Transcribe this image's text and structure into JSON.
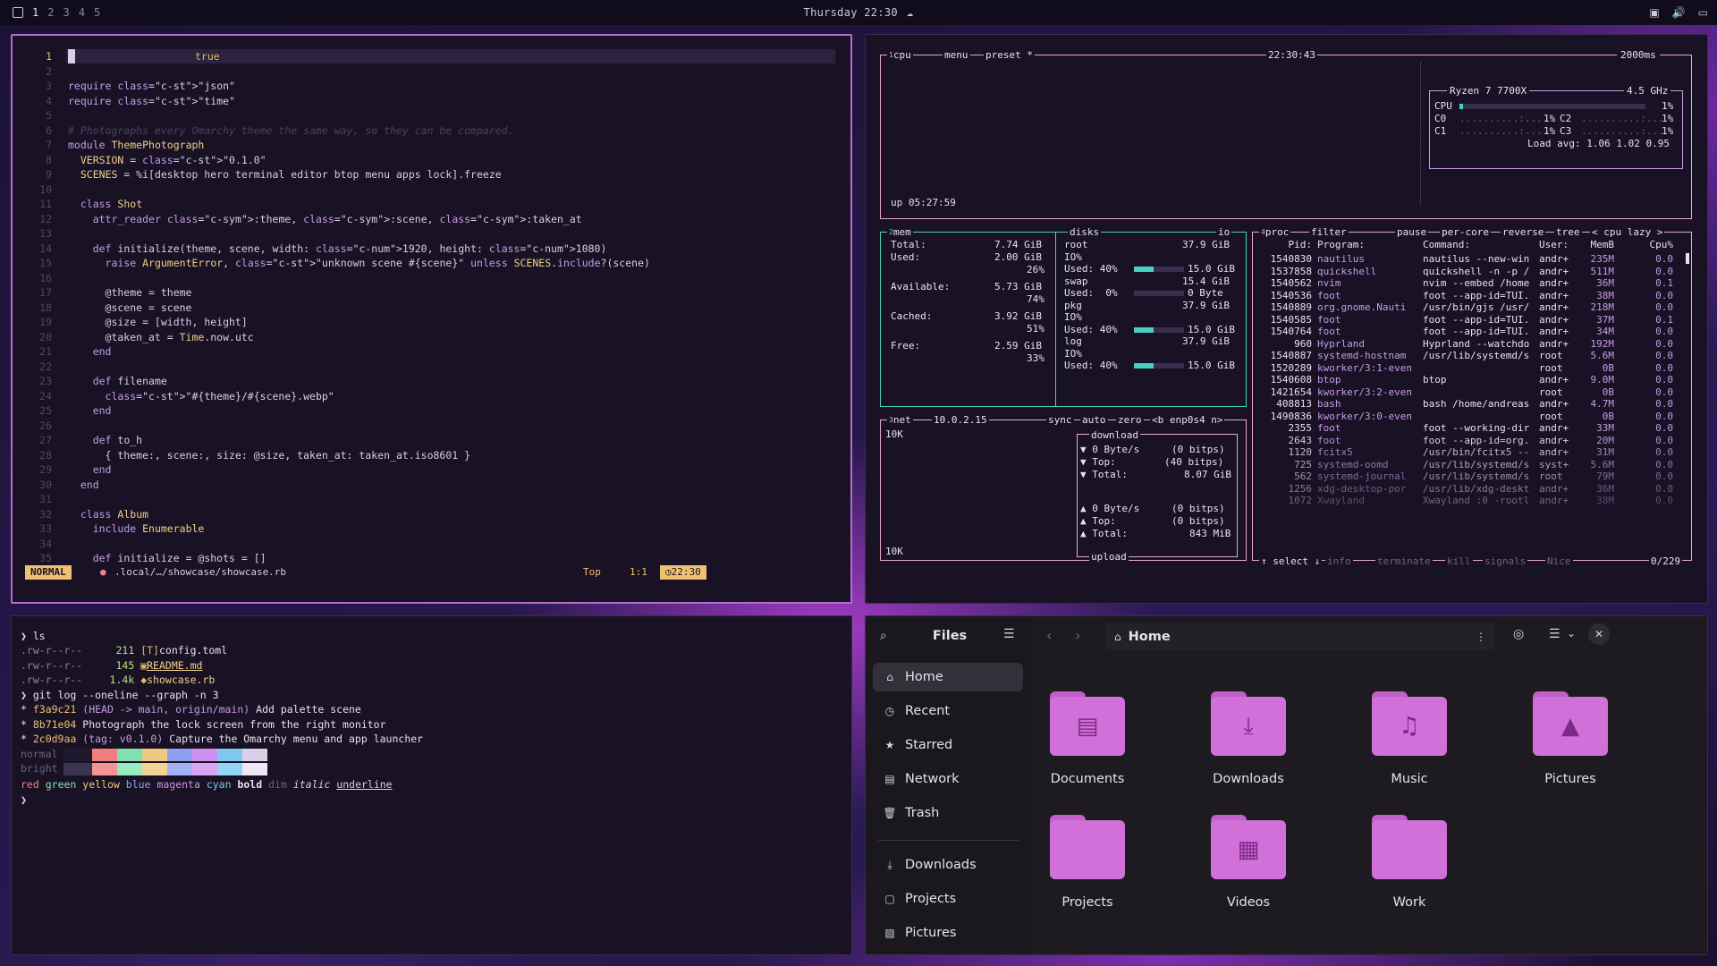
{
  "topbar": {
    "workspaces": [
      "1",
      "2",
      "3",
      "4",
      "5"
    ],
    "active_workspace": "1",
    "clock": "Thursday 22:30",
    "tray_icons": [
      "screen-icon",
      "volume-icon",
      "display-icon"
    ]
  },
  "editor": {
    "lines": [
      {
        "n": "1",
        "html": "#\t\t\t\t\t\ttrue"
      },
      {
        "n": "2",
        "text": ""
      },
      {
        "n": "3",
        "text": "require \"json\""
      },
      {
        "n": "4",
        "text": "require \"time\""
      },
      {
        "n": "5",
        "text": ""
      },
      {
        "n": "6",
        "text": "# Photographs every Omarchy theme the same way, so they can be compared."
      },
      {
        "n": "7",
        "text": "module ThemePhotograph"
      },
      {
        "n": "8",
        "text": "  VERSION = \"0.1.0\""
      },
      {
        "n": "9",
        "text": "  SCENES = %i[desktop hero terminal editor btop menu apps lock].freeze"
      },
      {
        "n": "10",
        "text": ""
      },
      {
        "n": "11",
        "text": "  class Shot"
      },
      {
        "n": "12",
        "text": "    attr_reader :theme, :scene, :taken_at"
      },
      {
        "n": "13",
        "text": ""
      },
      {
        "n": "14",
        "text": "    def initialize(theme, scene, width: 1920, height: 1080)"
      },
      {
        "n": "15",
        "text": "      raise ArgumentError, \"unknown scene #{scene}\" unless SCENES.include?(scene)"
      },
      {
        "n": "16",
        "text": ""
      },
      {
        "n": "17",
        "text": "      @theme = theme"
      },
      {
        "n": "18",
        "text": "      @scene = scene"
      },
      {
        "n": "19",
        "text": "      @size = [width, height]"
      },
      {
        "n": "20",
        "text": "      @taken_at = Time.now.utc"
      },
      {
        "n": "21",
        "text": "    end"
      },
      {
        "n": "22",
        "text": ""
      },
      {
        "n": "23",
        "text": "    def filename"
      },
      {
        "n": "24",
        "text": "      \"#{theme}/#{scene}.webp\""
      },
      {
        "n": "25",
        "text": "    end"
      },
      {
        "n": "26",
        "text": ""
      },
      {
        "n": "27",
        "text": "    def to_h"
      },
      {
        "n": "28",
        "text": "      { theme:, scene:, size: @size, taken_at: taken_at.iso8601 }"
      },
      {
        "n": "29",
        "text": "    end"
      },
      {
        "n": "30",
        "text": "  end"
      },
      {
        "n": "31",
        "text": ""
      },
      {
        "n": "32",
        "text": "  class Album"
      },
      {
        "n": "33",
        "text": "    include Enumerable"
      },
      {
        "n": "34",
        "text": ""
      },
      {
        "n": "35",
        "text": "    def initialize = @shots = []"
      }
    ],
    "first_line_value": "true",
    "mode": "NORMAL",
    "filepath": ".local/…/showcase/showcase.rb",
    "position": "Top",
    "rowcol": "1:1",
    "time": "22:30"
  },
  "btop": {
    "cpu_box": {
      "label": "cpu",
      "label_num": "1",
      "menu": "menu",
      "preset": "preset *",
      "time": "22:30:43",
      "interval": "2000ms",
      "uptime": "up 05:27:59",
      "cpu_name": "Ryzen 7 7700X",
      "freq": "4.5 GHz",
      "cpu_label": "CPU",
      "cpu_pct": "1%",
      "cores": [
        {
          "name": "C0",
          "pct": "1%"
        },
        {
          "name": "C1",
          "pct": "1%"
        },
        {
          "name": "C2",
          "pct": "1%"
        },
        {
          "name": "C3",
          "pct": "1%"
        }
      ],
      "load_avg": "Load avg: 1.06 1.02 0.95"
    },
    "mem_box": {
      "label": "mem",
      "label_num": "2",
      "disks_label": "disks",
      "io_label": "io",
      "total_label": "Total:",
      "total": "7.74 GiB",
      "used_label": "Used:",
      "used": "2.00 GiB",
      "used_pct": "26%",
      "avail_label": "Available:",
      "avail": "5.73 GiB",
      "avail_pct": "74%",
      "cached_label": "Cached:",
      "cached": "3.92 GiB",
      "cached_pct": "51%",
      "free_label": "Free:",
      "free": "2.59 GiB",
      "free_pct": "33%",
      "disks": [
        {
          "name": "root",
          "size": "37.9 GiB",
          "io": "IO%",
          "used_label": "Used: 40%",
          "used": "15.0 GiB",
          "fill": 0.4
        },
        {
          "name": "swap",
          "size": "15.4 GiB",
          "io": "",
          "used_label": "Used:  0%",
          "used": "0 Byte",
          "fill": 0.0
        },
        {
          "name": "pkg",
          "size": "37.9 GiB",
          "io": "IO%",
          "used_label": "Used: 40%",
          "used": "15.0 GiB",
          "fill": 0.4
        },
        {
          "name": "log",
          "size": "37.9 GiB",
          "io": "IO%",
          "used_label": "Used: 40%",
          "used": "15.0 GiB",
          "fill": 0.4
        }
      ]
    },
    "net_box": {
      "label": "net",
      "label_num": "3",
      "ip": "10.0.2.15",
      "sync": "sync",
      "auto": "auto",
      "zero": "zero",
      "iface": "<b enp0s4 n>",
      "scale_top": "10K",
      "scale_bottom": "10K",
      "download": "download",
      "dl_rate": "▼ 0 Byte/s",
      "dl_bits": "(0 bitps)",
      "dl_top": "▼ Top:",
      "dl_top_bits": "(40 bitps)",
      "dl_total": "▼ Total:",
      "dl_total_val": "8.07 GiB",
      "ul_rate": "▲ 0 Byte/s",
      "ul_bits": "(0 bitps)",
      "ul_top": "▲ Top:",
      "ul_top_bits": "(0 bitps)",
      "ul_total": "▲ Total:",
      "ul_total_val": "843 MiB",
      "upload": "upload"
    },
    "proc_box": {
      "label": "proc",
      "label_num": "4",
      "filter": "filter",
      "pause": "pause",
      "percore": "per-core",
      "reverse": "reverse",
      "tree": "tree",
      "sort": "< cpu lazy >",
      "headers": {
        "pid": "Pid:",
        "prog": "Program:",
        "cmd": "Command:",
        "user": "User:",
        "mem": "MemB",
        "cpu": "Cpu%"
      },
      "rows": [
        {
          "pid": "1540830",
          "prog": "nautilus",
          "cmd": "nautilus --new-win",
          "user": "andr+",
          "mem": "235M",
          "cpu": "0.0"
        },
        {
          "pid": "1537858",
          "prog": "quickshell",
          "cmd": "quickshell -n -p /",
          "user": "andr+",
          "mem": "511M",
          "cpu": "0.0"
        },
        {
          "pid": "1540562",
          "prog": "nvim",
          "cmd": "nvim --embed /home",
          "user": "andr+",
          "mem": "36M",
          "cpu": "0.1"
        },
        {
          "pid": "1540536",
          "prog": "foot",
          "cmd": "foot --app-id=TUI.",
          "user": "andr+",
          "mem": "38M",
          "cpu": "0.0"
        },
        {
          "pid": "1540889",
          "prog": "org.gnome.Nauti",
          "cmd": "/usr/bin/gjs /usr/",
          "user": "andr+",
          "mem": "218M",
          "cpu": "0.0"
        },
        {
          "pid": "1540585",
          "prog": "foot",
          "cmd": "foot --app-id=TUI.",
          "user": "andr+",
          "mem": "37M",
          "cpu": "0.1"
        },
        {
          "pid": "1540764",
          "prog": "foot",
          "cmd": "foot --app-id=TUI.",
          "user": "andr+",
          "mem": "34M",
          "cpu": "0.0"
        },
        {
          "pid": "960",
          "prog": "Hyprland",
          "cmd": "Hyprland --watchdo",
          "user": "andr+",
          "mem": "192M",
          "cpu": "0.0"
        },
        {
          "pid": "1540887",
          "prog": "systemd-hostnam",
          "cmd": "/usr/lib/systemd/s",
          "user": "root",
          "mem": "5.6M",
          "cpu": "0.0"
        },
        {
          "pid": "1520289",
          "prog": "kworker/3:1-even",
          "cmd": "",
          "user": "root",
          "mem": "0B",
          "cpu": "0.0"
        },
        {
          "pid": "1540608",
          "prog": "btop",
          "cmd": "btop",
          "user": "andr+",
          "mem": "9.0M",
          "cpu": "0.0"
        },
        {
          "pid": "1421654",
          "prog": "kworker/3:2-even",
          "cmd": "",
          "user": "root",
          "mem": "0B",
          "cpu": "0.0"
        },
        {
          "pid": "408813",
          "prog": "bash",
          "cmd": "bash /home/andreas",
          "user": "andr+",
          "mem": "4.7M",
          "cpu": "0.0"
        },
        {
          "pid": "1490836",
          "prog": "kworker/3:0-even",
          "cmd": "",
          "user": "root",
          "mem": "0B",
          "cpu": "0.0"
        },
        {
          "pid": "2355",
          "prog": "foot",
          "cmd": "foot --working-dir",
          "user": "andr+",
          "mem": "33M",
          "cpu": "0.0"
        },
        {
          "pid": "2643",
          "prog": "foot",
          "cmd": "foot --app-id=org.",
          "user": "andr+",
          "mem": "20M",
          "cpu": "0.0"
        },
        {
          "pid": "1120",
          "prog": "fcitx5",
          "cmd": "/usr/bin/fcitx5 --",
          "user": "andr+",
          "mem": "31M",
          "cpu": "0.0"
        },
        {
          "pid": "725",
          "prog": "systemd-oomd",
          "cmd": "/usr/lib/systemd/s",
          "user": "syst+",
          "mem": "5.6M",
          "cpu": "0.0"
        },
        {
          "pid": "562",
          "prog": "systemd-journal",
          "cmd": "/usr/lib/systemd/s",
          "user": "root",
          "mem": "79M",
          "cpu": "0.0"
        },
        {
          "pid": "1256",
          "prog": "xdg-desktop-por",
          "cmd": "/usr/lib/xdg-deskt",
          "user": "andr+",
          "mem": "36M",
          "cpu": "0.0"
        },
        {
          "pid": "1072",
          "prog": "Xwayland",
          "cmd": "Xwayland :0 -rootl",
          "user": "andr+",
          "mem": "38M",
          "cpu": "0.0"
        }
      ],
      "footer_select": "↑ select ↓",
      "footer_info": "info",
      "footer_terminate": "terminate",
      "footer_kill": "kill",
      "footer_signals": "signals",
      "footer_nice": "Nice",
      "count": "0/229"
    }
  },
  "terminal": {
    "prompt": "❯",
    "cmd1": "ls",
    "files": [
      {
        "perm": ".rw-r--r--",
        "size": "211",
        "icon": "[T]",
        "name": "config.toml"
      },
      {
        "perm": ".rw-r--r--",
        "size": "145",
        "icon": "▣",
        "name": "README.md"
      },
      {
        "perm": ".rw-r--r--",
        "size": "1.4k",
        "icon": "◆",
        "name": "showcase.rb"
      }
    ],
    "cmd2": "git log --oneline --graph -n 3",
    "commits": [
      {
        "hash": "f3a9c21",
        "ref": "(HEAD -> main, origin/main)",
        "msg": "Add palette scene"
      },
      {
        "hash": "8b71e04",
        "ref": "",
        "msg": "Photograph the lock screen from the right monitor"
      },
      {
        "hash": "2c0d9aa",
        "ref": "(tag: v0.1.0)",
        "msg": "Capture the Omarchy menu and app launcher"
      }
    ],
    "normal_label": "normal",
    "bright_label": "bright",
    "normal_colors": [
      "#1e1a2e",
      "#f08080",
      "#80e0b0",
      "#f0c880",
      "#90a0f0",
      "#d090f0",
      "#80c8f0",
      "#d8d0e8"
    ],
    "bright_colors": [
      "#3a3450",
      "#f49494",
      "#94ecc0",
      "#f4d494",
      "#a4b0f4",
      "#dca4f4",
      "#94d4f4",
      "#eee8f6"
    ],
    "styles": [
      "red",
      "green",
      "yellow",
      "blue",
      "magenta",
      "cyan",
      "bold",
      "dim",
      "italic",
      "underline"
    ]
  },
  "files": {
    "sidebar_title": "Files",
    "path": "Home",
    "sidebar_items": [
      {
        "label": "Home",
        "icon": "home-icon",
        "selected": true
      },
      {
        "label": "Recent",
        "icon": "clock-icon",
        "selected": false
      },
      {
        "label": "Starred",
        "icon": "star-icon",
        "selected": false
      },
      {
        "label": "Network",
        "icon": "network-icon",
        "selected": false
      },
      {
        "label": "Trash",
        "icon": "trash-icon",
        "selected": false
      }
    ],
    "bookmarks": [
      {
        "label": "Downloads",
        "icon": "download-icon"
      },
      {
        "label": "Projects",
        "icon": "folder-icon"
      },
      {
        "label": "Pictures",
        "icon": "image-icon"
      }
    ],
    "folders": [
      {
        "label": "Documents",
        "icon": "document-icon"
      },
      {
        "label": "Downloads",
        "icon": "download-icon"
      },
      {
        "label": "Music",
        "icon": "music-icon"
      },
      {
        "label": "Pictures",
        "icon": "image-icon"
      },
      {
        "label": "Projects",
        "icon": "folder-icon"
      },
      {
        "label": "Videos",
        "icon": "film-icon"
      },
      {
        "label": "Work",
        "icon": "folder-icon"
      }
    ]
  }
}
